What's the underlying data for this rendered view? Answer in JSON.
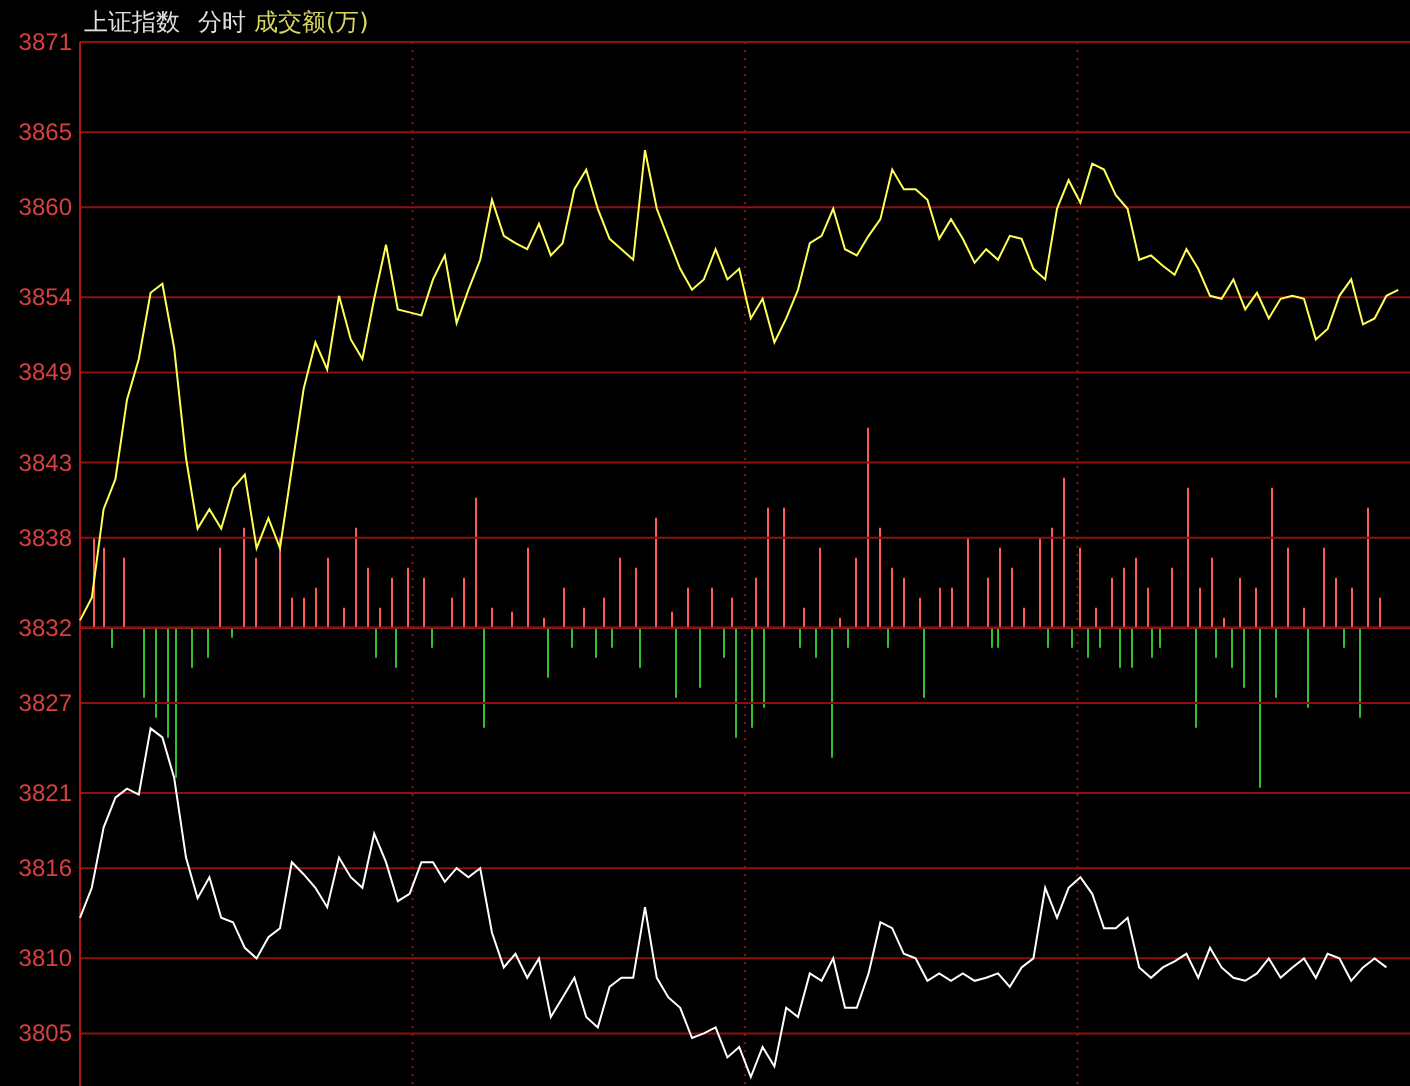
{
  "header": {
    "index_name": "上证指数",
    "period": "分时",
    "metric": "成交额(万)"
  },
  "chart": {
    "chart_data": {
      "type": "line",
      "ylim": [
        3801.5,
        3871
      ],
      "yticks": [
        3871,
        3865,
        3860,
        3854,
        3849,
        3843,
        3838,
        3832,
        3827,
        3821,
        3816,
        3810,
        3805
      ],
      "grid": true,
      "series": [
        {
          "color": "#ffff55",
          "values": [
            3832.5,
            3834.0,
            3839.9,
            3841.9,
            3847.2,
            3849.9,
            3854.3,
            3854.9,
            3850.6,
            3843.3,
            3838.6,
            3839.9,
            3838.6,
            3841.3,
            3842.2,
            3837.3,
            3839.3,
            3837.3,
            3842.6,
            3847.9,
            3851.0,
            3849.2,
            3854.1,
            3851.2,
            3849.9,
            3853.9,
            3857.5,
            3853.2,
            3853.0,
            3852.8,
            3855.2,
            3856.8,
            3852.3,
            3854.5,
            3856.5,
            3860.5,
            3858.1,
            3857.6,
            3857.2,
            3858.9,
            3856.8,
            3857.6,
            3861.2,
            3862.5,
            3859.9,
            3857.9,
            3857.2,
            3856.5,
            3863.8,
            3859.9,
            3857.9,
            3855.9,
            3854.5,
            3855.2,
            3857.2,
            3855.2,
            3855.9,
            3852.6,
            3853.9,
            3851.0,
            3852.6,
            3854.5,
            3857.6,
            3858.1,
            3859.9,
            3857.2,
            3856.8,
            3858.1,
            3859.2,
            3862.5,
            3861.2,
            3861.2,
            3860.5,
            3857.9,
            3859.2,
            3857.9,
            3856.3,
            3857.2,
            3856.5,
            3858.1,
            3857.9,
            3855.9,
            3855.2,
            3859.9,
            3861.8,
            3860.3,
            3862.9,
            3862.5,
            3860.8,
            3859.9,
            3856.5,
            3856.8,
            3856.1,
            3855.5,
            3857.2,
            3855.9,
            3854.1,
            3853.9,
            3855.2,
            3853.2,
            3854.3,
            3852.6,
            3853.9,
            3854.1,
            3853.9,
            3851.2,
            3851.9,
            3854.1,
            3855.2,
            3852.2,
            3852.6,
            3854.1,
            3854.5
          ]
        },
        {
          "color": "#ffffff",
          "values": [
            3812.7,
            3814.7,
            3818.7,
            3820.7,
            3821.3,
            3820.9,
            3825.3,
            3824.7,
            3822.0,
            3816.7,
            3814.0,
            3815.4,
            3812.7,
            3812.4,
            3810.7,
            3810.0,
            3811.4,
            3812.0,
            3816.4,
            3815.6,
            3814.7,
            3813.4,
            3816.7,
            3815.4,
            3814.7,
            3818.3,
            3816.4,
            3813.8,
            3814.3,
            3816.4,
            3816.4,
            3815.1,
            3816.0,
            3815.4,
            3816.0,
            3811.7,
            3809.4,
            3810.3,
            3808.7,
            3810.0,
            3806.1,
            3807.4,
            3808.7,
            3806.1,
            3805.4,
            3808.1,
            3808.7,
            3808.7,
            3813.4,
            3808.7,
            3807.4,
            3806.7,
            3804.7,
            3805.0,
            3805.4,
            3803.4,
            3804.1,
            3802.1,
            3804.1,
            3802.8,
            3806.7,
            3806.1,
            3809.0,
            3808.5,
            3810.0,
            3806.7,
            3806.7,
            3809.0,
            3812.4,
            3812.0,
            3810.3,
            3810.0,
            3808.5,
            3809.0,
            3808.5,
            3809.0,
            3808.5,
            3808.7,
            3809.0,
            3808.1,
            3809.4,
            3810.0,
            3814.7,
            3812.7,
            3814.7,
            3815.4,
            3814.3,
            3812.0,
            3812.0,
            3812.7,
            3809.4,
            3808.7,
            3809.4,
            3809.8,
            3810.3,
            3808.7,
            3810.7,
            3809.4,
            3808.7,
            3808.5,
            3809.0,
            3810.0,
            3808.7,
            3809.4,
            3810.0,
            3808.7,
            3810.3,
            3810.0,
            3808.5,
            3809.4,
            3810.0,
            3809.4
          ]
        }
      ]
    }
  }
}
